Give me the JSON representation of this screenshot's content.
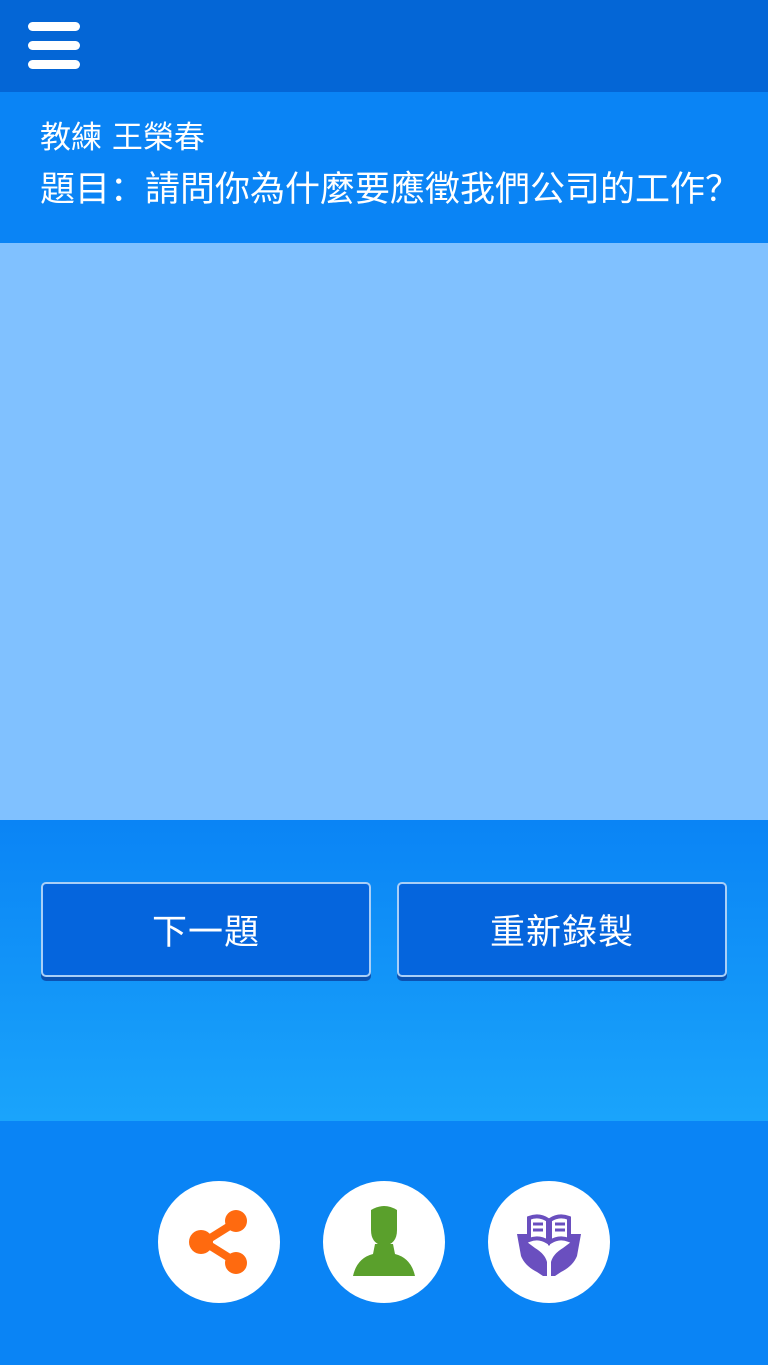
{
  "topbar": {
    "menu_icon": "hamburger-menu-icon"
  },
  "header": {
    "coach_label": "教練 王榮春",
    "question_label": "題目：請問你為什麼要應徵我們公司的工作？"
  },
  "buttons": {
    "next_label": "下一題",
    "redo_label": "重新錄製"
  },
  "footer": {
    "icons": [
      "share-icon",
      "user-profile-icon",
      "book-in-hands-icon"
    ]
  },
  "colors": {
    "topbar": "#0466d6",
    "primary": "#0a84f5",
    "video_area": "#80c1ff",
    "button": "#0565dd",
    "share_icon": "#ff6a0f",
    "user_icon": "#5aa02c",
    "book_icon": "#6a4fbf"
  }
}
